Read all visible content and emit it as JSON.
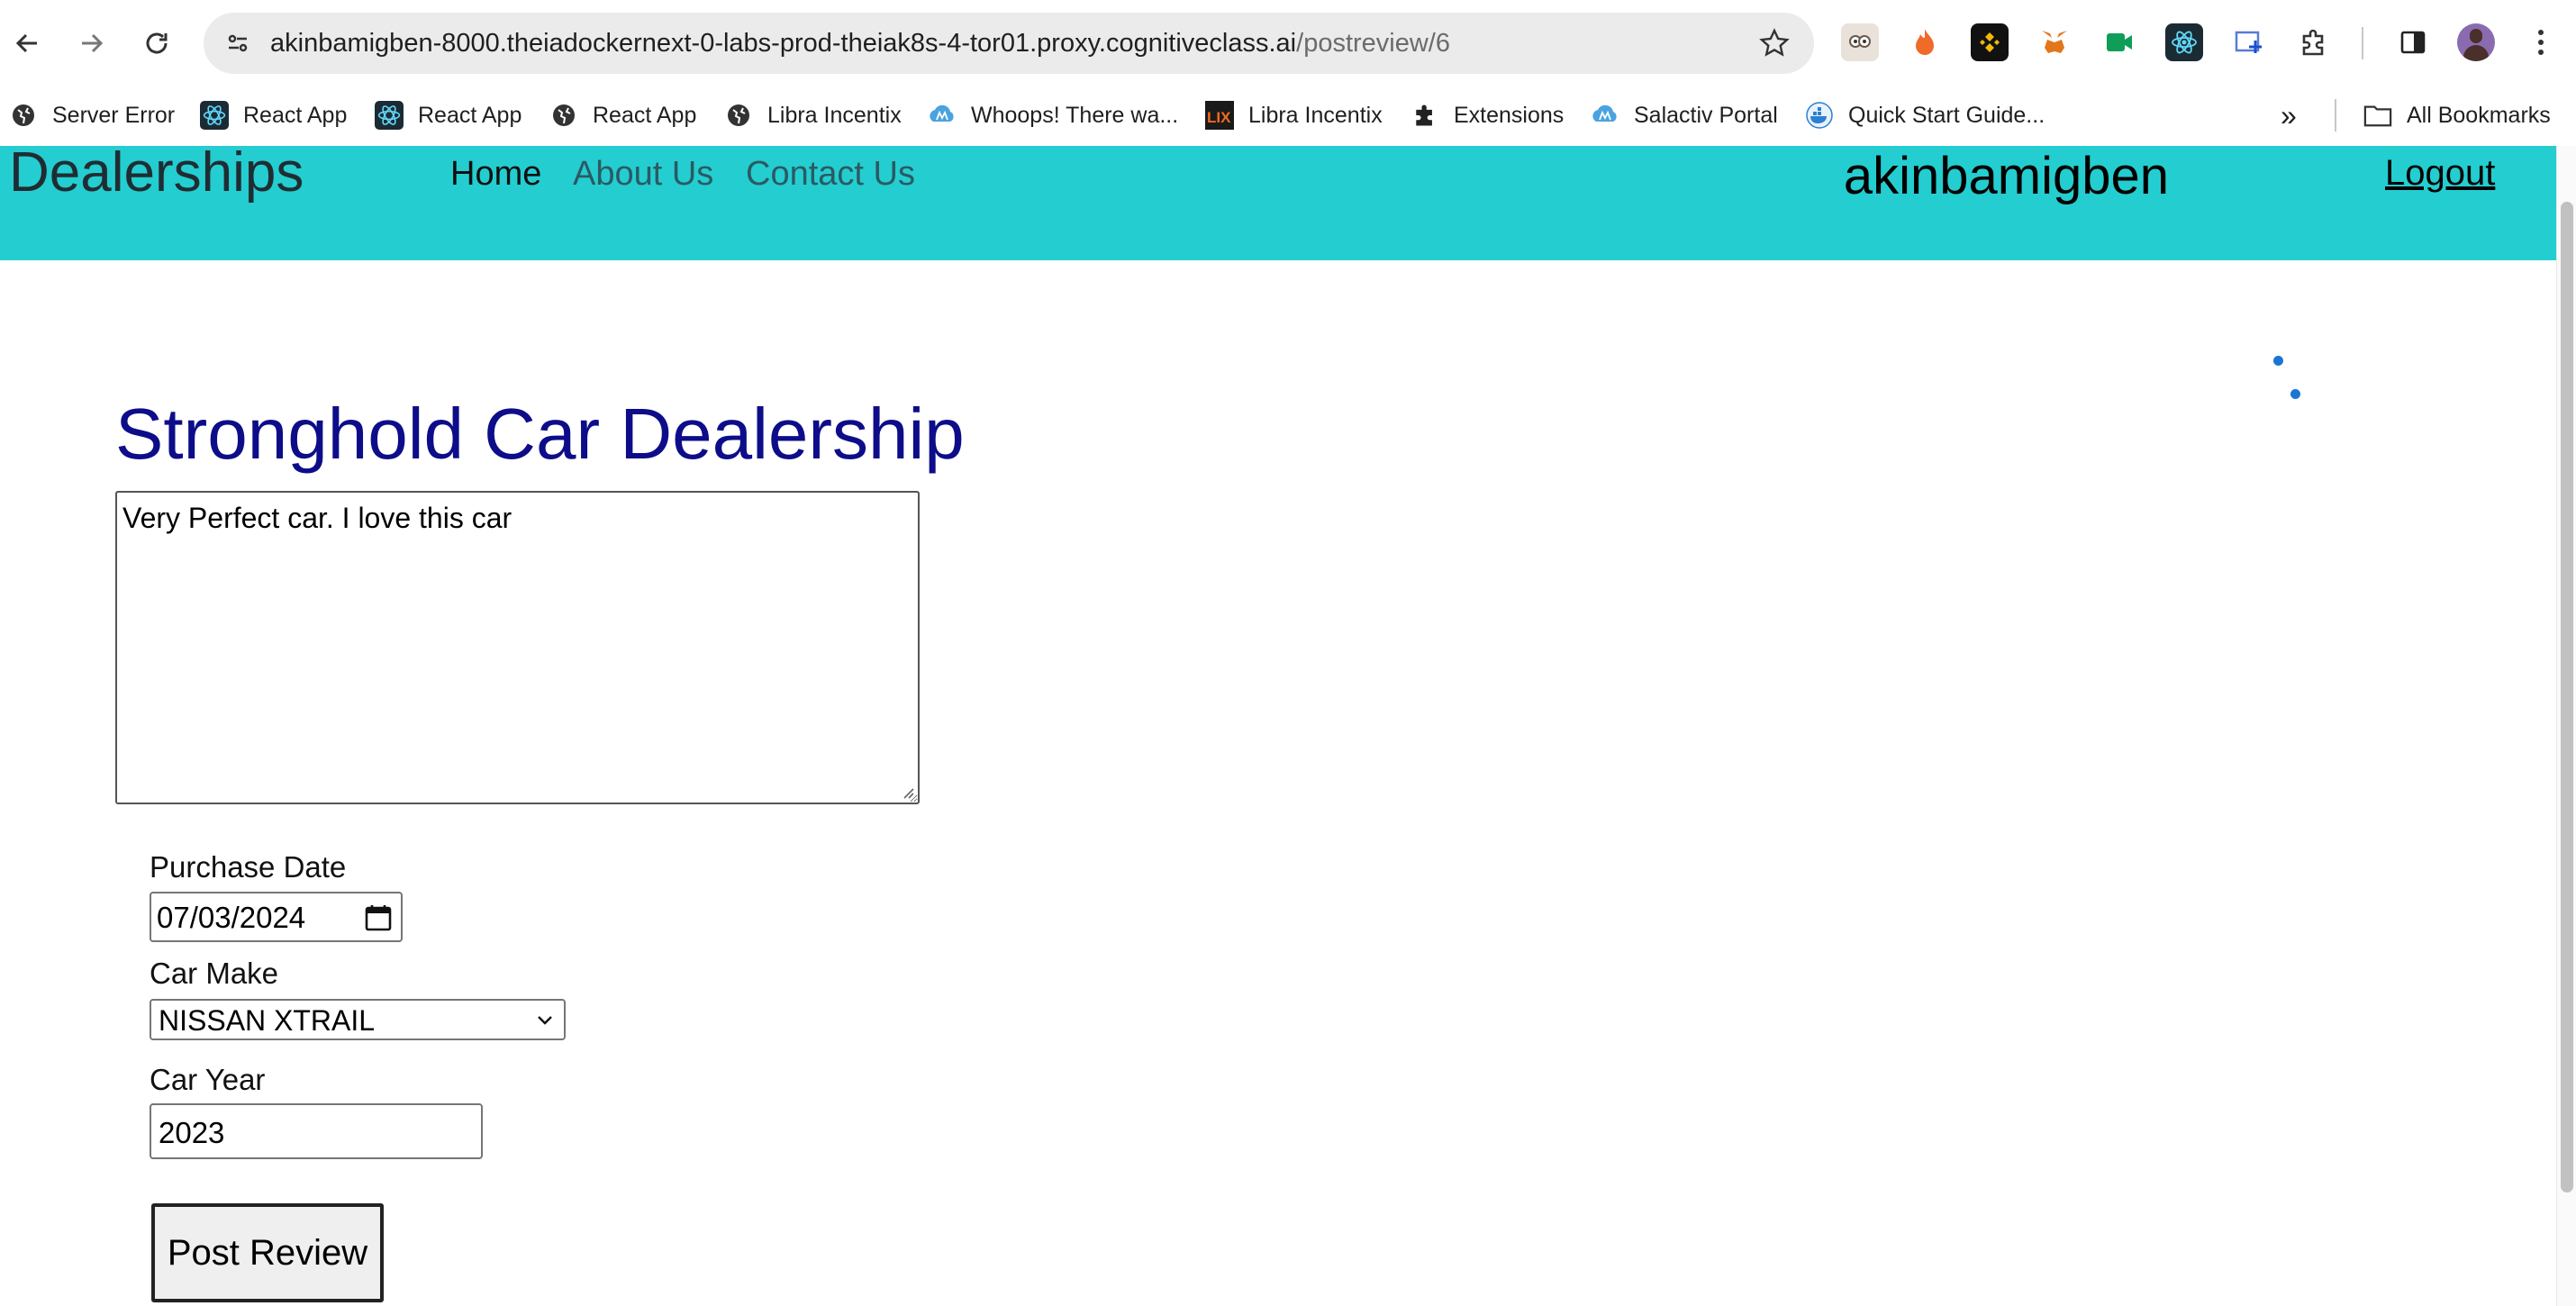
{
  "browser": {
    "url_host": "akinbamigben-8000.theiadockernext-0-labs-prod-theiak8s-4-tor01.proxy.cognitiveclass.ai",
    "url_path": "/postreview/6",
    "bookmarks": [
      {
        "label": "Server Error",
        "icon": "globe-icon"
      },
      {
        "label": "React App",
        "icon": "react-icon"
      },
      {
        "label": "React App",
        "icon": "react-icon"
      },
      {
        "label": "React App",
        "icon": "globe-icon"
      },
      {
        "label": "Libra Incentix",
        "icon": "globe-icon"
      },
      {
        "label": "Whoops! There wa...",
        "icon": "cloud-icon"
      },
      {
        "label": "Libra Incentix",
        "icon": "lix-icon"
      },
      {
        "label": "Extensions",
        "icon": "puzzle-icon"
      },
      {
        "label": "Salactiv Portal",
        "icon": "cloud-icon"
      },
      {
        "label": "Quick Start Guide...",
        "icon": "docker-icon"
      }
    ],
    "more_bookmarks": "»",
    "all_bookmarks": "All Bookmarks"
  },
  "header": {
    "brand": "Dealerships",
    "nav": {
      "home": "Home",
      "about": "About Us",
      "contact": "Contact Us"
    },
    "username": "akinbamigben",
    "logout": "Logout",
    "bg_color": "#24cdd0"
  },
  "form": {
    "dealer_name": "Stronghold Car Dealership",
    "review_text": "Very Perfect car. I love this car",
    "purchase_date_label": "Purchase Date",
    "purchase_date_value": "07/03/2024",
    "car_make_label": "Car Make",
    "car_make_value": "NISSAN XTRAIL",
    "car_year_label": "Car Year",
    "car_year_value": "2023",
    "submit_label": "Post Review",
    "title_color": "#0d0d8a"
  }
}
